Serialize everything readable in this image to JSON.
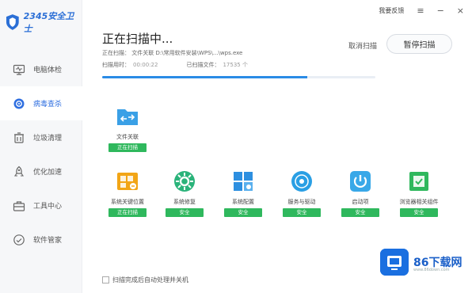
{
  "app": {
    "logo_text": "2345安全卫士"
  },
  "topbar": {
    "feedback": "我要反馈",
    "menu_icon": "≡",
    "minimize_icon": "−",
    "close_icon": "×"
  },
  "sidebar": {
    "items": [
      {
        "label": "电脑体检",
        "icon": "monitor-icon",
        "active": false
      },
      {
        "label": "病毒查杀",
        "icon": "virus-scan-icon",
        "active": true
      },
      {
        "label": "垃圾清理",
        "icon": "trash-icon",
        "active": false
      },
      {
        "label": "优化加速",
        "icon": "rocket-icon",
        "active": false
      },
      {
        "label": "工具中心",
        "icon": "toolbox-icon",
        "active": false
      },
      {
        "label": "软件管家",
        "icon": "software-icon",
        "active": false
      }
    ]
  },
  "scan": {
    "title": "正在扫描中...",
    "current_label": "正在扫描：",
    "current_value": "文件关联  D:\\常用软件安装\\WPS\\...\\wps.exe",
    "time_label": "扫描用时：",
    "time_value": "00:00:22",
    "count_label": "已扫描文件：",
    "count_value": "17535 个",
    "progress": 0.75
  },
  "actions": {
    "cancel": "取消扫描",
    "pause": "暂停扫描"
  },
  "scan_items": [
    {
      "label": "文件关联",
      "status": "正在扫描",
      "icon": "file-association-icon",
      "color": "#3aa0e6"
    },
    {
      "label": "系统关键位置",
      "status": "正在扫描",
      "icon": "system-key-location-icon",
      "color": "#f2a516"
    },
    {
      "label": "系统修复",
      "status": "安全",
      "icon": "system-repair-icon",
      "color": "#2ab37a"
    },
    {
      "label": "系统配置",
      "status": "安全",
      "icon": "system-config-icon",
      "color": "#2d8fe0"
    },
    {
      "label": "服务与驱动",
      "status": "安全",
      "icon": "service-driver-icon",
      "color": "#2a9fe4"
    },
    {
      "label": "启动项",
      "status": "安全",
      "icon": "startup-icon",
      "color": "#39a8e8"
    },
    {
      "label": "浏览器相关组件",
      "status": "安全",
      "icon": "browser-component-icon",
      "color": "#2fb85d"
    }
  ],
  "footer": {
    "checkbox_label": "扫描完成后自动处理并关机"
  },
  "watermark": {
    "text": "86下载网",
    "sub": "www.86down.com"
  }
}
